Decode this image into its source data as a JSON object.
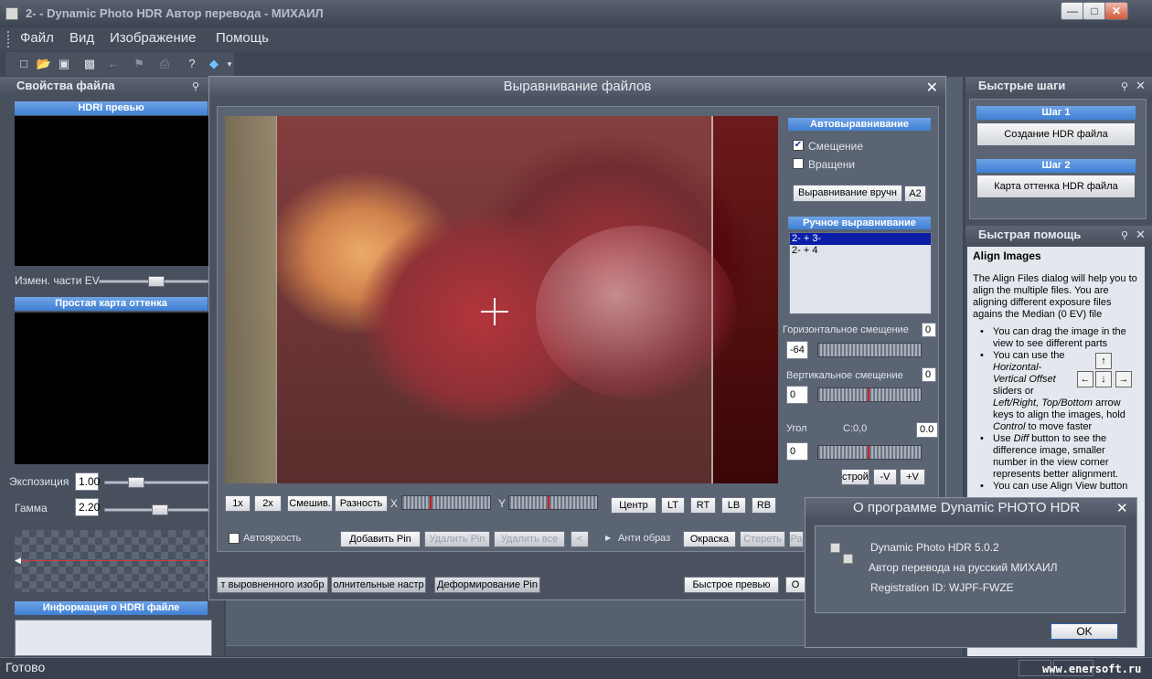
{
  "window": {
    "title": "2- - Dynamic Photo HDR   Автор перевода - МИХАИЛ"
  },
  "menu": [
    "Файл",
    "Вид",
    "Изображение",
    "Помощь"
  ],
  "left_panel": {
    "title": "Свойства файла",
    "preview_band": "HDRI превью",
    "ev_label": "Измен.  части EV",
    "tonemap_band": "Простая карта оттенка",
    "exposure_label": "Экспозиция",
    "exposure_value": "1.00",
    "gamma_label": "Гамма",
    "gamma_value": "2.20",
    "info_band": "Информация о HDRI файле"
  },
  "align_dialog": {
    "title": "Выравнивание файлов",
    "auto_band": "Автовыравнивание",
    "offset_label": "Смещение",
    "rotation_label": "Вращени",
    "manual_align_button": "Выравнивание вручн",
    "a2_button": "A2",
    "manual_band": "Ручное выравнивание",
    "list_items": [
      "2- + 3-",
      "2- + 4"
    ],
    "h_offset_label": "Горизонтальное смещение",
    "h_offset_reset": "0",
    "h_offset_value": "-64",
    "v_offset_label": "Вертикальное смещение",
    "v_offset_reset": "0",
    "v_offset_value": "0",
    "angle_label": "Угол",
    "angle_center": "C:0,0",
    "angle_reset": "0.0",
    "angle_value": "0",
    "adjust_button": "строй",
    "minus_v_button": "-V",
    "plus_v_button": "+V",
    "zoom_1x": "1x",
    "zoom_2x": "2x",
    "mix_button": "Смешив.",
    "diff_button": "Разность",
    "x_label": "X",
    "y_label": "Y",
    "center_button": "Центр",
    "lt_button": "LT",
    "rt_button": "RT",
    "lb_button": "LB",
    "rb_button": "RB",
    "autobright_label": "Автояркость",
    "add_pin_button": "Добавить Pin",
    "delete_pin_button": "Удалить Pin",
    "delete_all_button": "Удалить все",
    "anti_image_label": "Анти образ",
    "paint_button": "Окраска",
    "erase_button": "Стереть",
    "ra_button": "Ра",
    "tab_aligned": "т выровненного изобр",
    "tab_extra": "олнительные настр",
    "tab_deform": "Деформирование Pin",
    "quick_preview_button": "Быстрое превью",
    "truncated_button": "О"
  },
  "right_panel": {
    "quick_steps_title": "Быстрые шаги",
    "step1_band": "Шаг 1",
    "step1_button": "Создание HDR файла",
    "step2_band": "Шаг 2",
    "step2_button": "Карта оттенка HDR файла",
    "quick_help_title": "Быстрая помощь",
    "help_heading": "Align Images",
    "help_intro": "The Align Files dialog will help you to align the multiple files. You are aligning different exposure files agains the Median (0 EV) file",
    "help_b1": "You can drag the image in the view to see different parts",
    "help_b2_pre": "You can use the ",
    "help_b2_em1": "Horizontal-Vertical Offset",
    "help_b2_mid": " sliders or ",
    "help_b2_em2": "Left/Right, Top/Bottom",
    "help_b2_mid2": " arrow keys to align the images, hold ",
    "help_b2_em3": "Control",
    "help_b2_post": " to move faster",
    "help_b3_pre": "Use ",
    "help_b3_em": "Diff",
    "help_b3_post": " button to see the difference image, smaller number in the view corner represents better alignment.",
    "help_b4": "You can use Align View button"
  },
  "about_dialog": {
    "title": "О программе Dynamic PHOTO HDR",
    "version": "Dynamic Photo HDR 5.0.2",
    "translator": "Автор перевода на русский МИХАИЛ",
    "registration": "Registration ID: WJPF-FWZE",
    "ok_button": "OK"
  },
  "status": {
    "text": "Готово",
    "watermark": "www.enersoft.ru"
  },
  "icons": [
    "app-icon",
    "new-file-icon",
    "open-folder-icon",
    "save-icon",
    "save-as-icon",
    "undo-icon",
    "flag-icon",
    "print-icon",
    "help-icon",
    "book-icon",
    "pin-icon",
    "close-icon",
    "checkmark-icon",
    "crosshair-icon",
    "arrow-key-icons"
  ]
}
